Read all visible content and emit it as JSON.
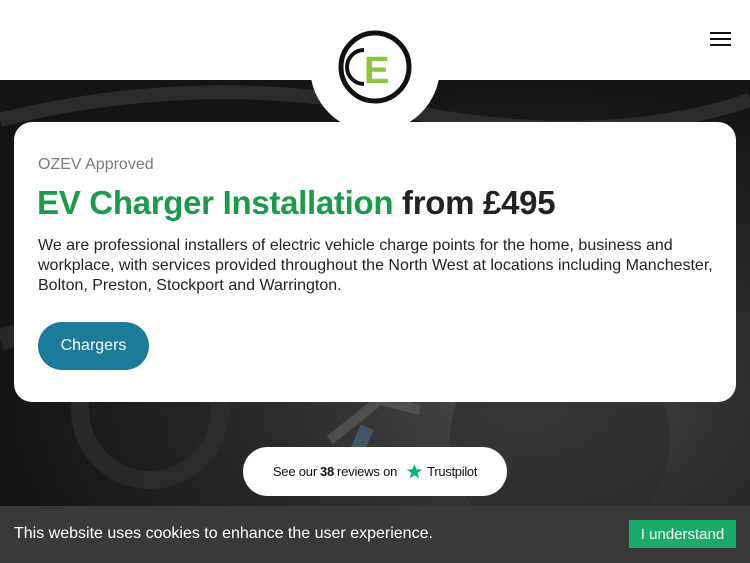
{
  "brand": {
    "logo_letter": "E",
    "logo_icon": "oce-logo-icon"
  },
  "header": {
    "menu_icon": "hamburger-menu-icon"
  },
  "hero": {
    "eyebrow": "OZEV Approved",
    "headline_green": "EV Charger Installation",
    "headline_rest": " from £495",
    "description": "We are professional installers of electric vehicle charge points for the home, business and workplace, with services provided throughout the North West at locations including Manchester, Bolton, Preston, Stockport and Warrington.",
    "cta_label": "Chargers"
  },
  "reviews": {
    "prefix": "See our",
    "count": "38",
    "suffix": "reviews on",
    "brand": "Trustpilot",
    "brand_icon": "trustpilot-star-icon"
  },
  "cookie": {
    "message": "This website uses cookies to enhance the user experience.",
    "button_label": "I understand"
  },
  "colors": {
    "accent_green": "#1c9a4b",
    "cta_blue": "#1d7b9a",
    "cookie_button": "#1aab6b",
    "trustpilot_green": "#00b67a"
  }
}
